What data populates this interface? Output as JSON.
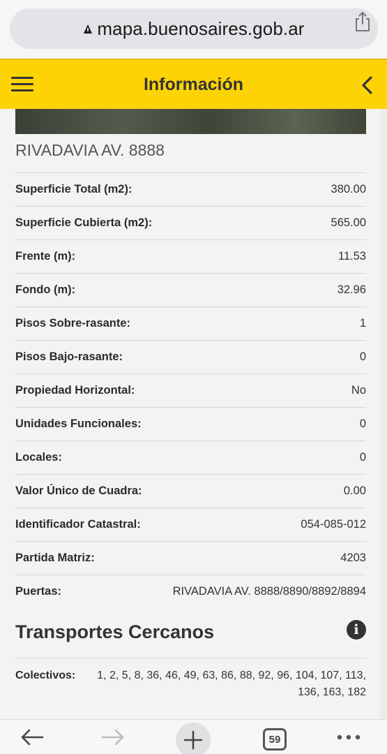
{
  "browser": {
    "url": "mapa.buenosaires.gob.ar",
    "icons": [
      "lock-icon",
      "share-icon"
    ]
  },
  "header": {
    "title": "Información",
    "icons": [
      "hamburger-menu-icon",
      "chevron-left-icon"
    ],
    "color": "#fdd306"
  },
  "parcel": {
    "address": "RIVADAVIA AV. 8888",
    "fields": [
      {
        "label": "Superficie Total (m2):",
        "value": "380.00"
      },
      {
        "label": "Superficie Cubierta (m2):",
        "value": "565.00"
      },
      {
        "label": "Frente (m):",
        "value": "11.53"
      },
      {
        "label": "Fondo (m):",
        "value": "32.96"
      },
      {
        "label": "Pisos Sobre-rasante:",
        "value": "1"
      },
      {
        "label": "Pisos Bajo-rasante:",
        "value": "0"
      },
      {
        "label": "Propiedad Horizontal:",
        "value": "No"
      },
      {
        "label": "Unidades Funcionales:",
        "value": "0"
      },
      {
        "label": "Locales:",
        "value": "0"
      },
      {
        "label": "Valor Único de Cuadra:",
        "value": "0.00"
      },
      {
        "label": "Identificador Catastral:",
        "value": "054-085-012"
      },
      {
        "label": "Partida Matriz:",
        "value": "4203"
      },
      {
        "label": "Puertas:",
        "value": "RIVADAVIA AV. 8888/8890/8892/8894"
      }
    ]
  },
  "transport": {
    "title": "Transportes Cercanos",
    "colectivos_label": "Colectivos:",
    "colectivos_line1": "1, 2, 5, 8, 36, 46, 49, 63, 86, 88, 92, 96, 104, 107, 113,",
    "colectivos_line2": "136, 163, 182"
  },
  "toolbar": {
    "tab_count": "59",
    "icons": [
      "back-arrow-icon",
      "forward-arrow-icon",
      "plus-icon",
      "tabs-icon",
      "more-icon"
    ]
  }
}
